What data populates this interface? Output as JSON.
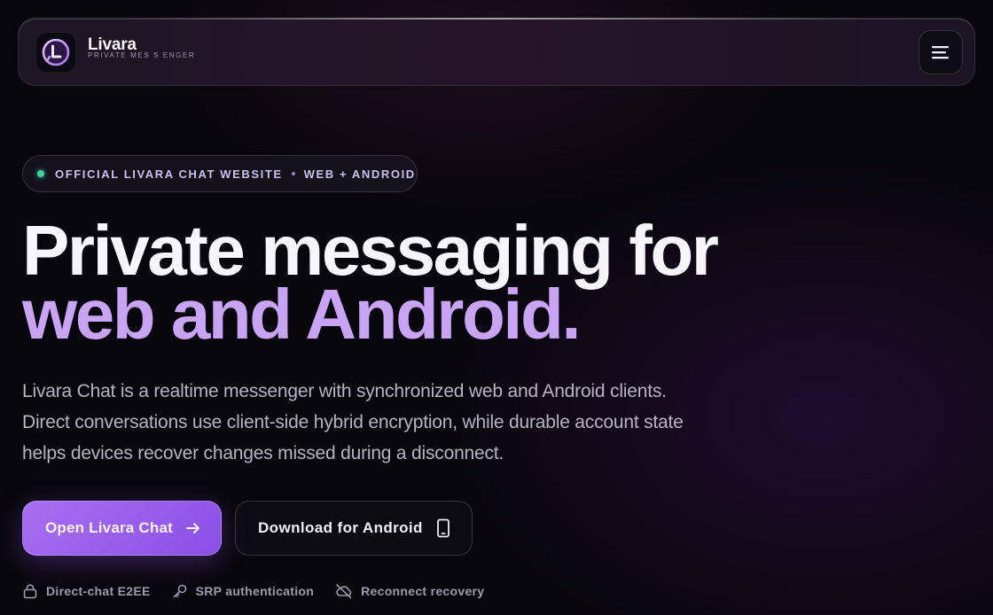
{
  "brand": {
    "name": "Livara",
    "tagline": "PRIVATE MES S ENGER"
  },
  "nav": {
    "menu_icon": "menu-icon"
  },
  "badge": {
    "left": "OFFICIAL LIVARA CHAT WEBSITE",
    "right": "WEB + ANDROID"
  },
  "hero": {
    "title_line1": "Private messaging for",
    "title_line2": "web and Android.",
    "lead": "Livara Chat is a realtime messenger with synchronized web and Android clients. Direct conversations use client-side hybrid encryption, while durable account state helps devices recover changes missed during a disconnect."
  },
  "buttons": {
    "primary": "Open Livara Chat",
    "secondary": "Download for Android"
  },
  "features": [
    {
      "label": "Direct-chat E2EE",
      "icon": "lock-icon"
    },
    {
      "label": "SRP authentication",
      "icon": "key-icon"
    },
    {
      "label": "Reconnect recovery",
      "icon": "cloud-off-icon"
    }
  ],
  "colors": {
    "accent": "#c9a4f4",
    "primary_button": "#9a5ff0",
    "status_dot": "#3fd49a",
    "background": "#08070c"
  }
}
